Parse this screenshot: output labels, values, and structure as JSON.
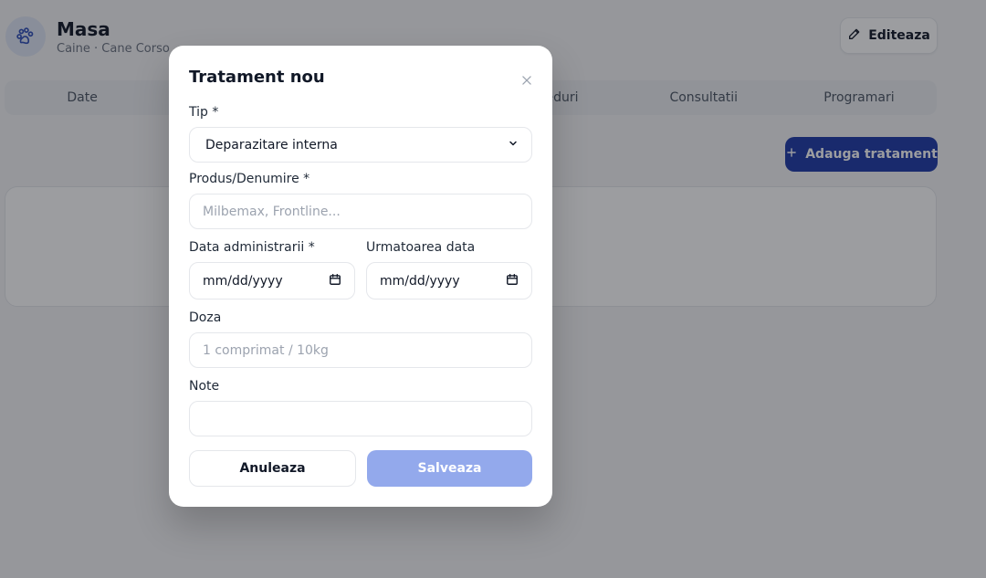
{
  "pet": {
    "name": "Masa",
    "subtitle": "Caine · Cane Corso",
    "avatar_icon": "paw-icon"
  },
  "header": {
    "edit_label": "Editeaza"
  },
  "tabs": [
    {
      "label": "Date"
    },
    {
      "label": ""
    },
    {
      "label": ""
    },
    {
      "label": "Proceduri"
    },
    {
      "label": "Consultatii"
    },
    {
      "label": "Programari"
    }
  ],
  "actions": {
    "add_treatment_label": "Adauga tratament"
  },
  "modal": {
    "title": "Tratament nou",
    "type": {
      "label": "Tip *",
      "value": "Deparazitare interna"
    },
    "product": {
      "label": "Produs/Denumire *",
      "placeholder": "Milbemax, Frontline..."
    },
    "admin_date": {
      "label": "Data administrarii *",
      "value": "mm/dd/yyyy"
    },
    "next_date": {
      "label": "Urmatoarea data",
      "value": "mm/dd/yyyy"
    },
    "dose": {
      "label": "Doza",
      "placeholder": "1 comprimat / 10kg"
    },
    "notes": {
      "label": "Note",
      "placeholder": ""
    },
    "cancel_label": "Anuleaza",
    "save_label": "Salveaza"
  },
  "colors": {
    "primary": "#1e3aa8",
    "primary_disabled": "#93a9ec",
    "overlay": "rgba(20,22,28,0.42)"
  }
}
